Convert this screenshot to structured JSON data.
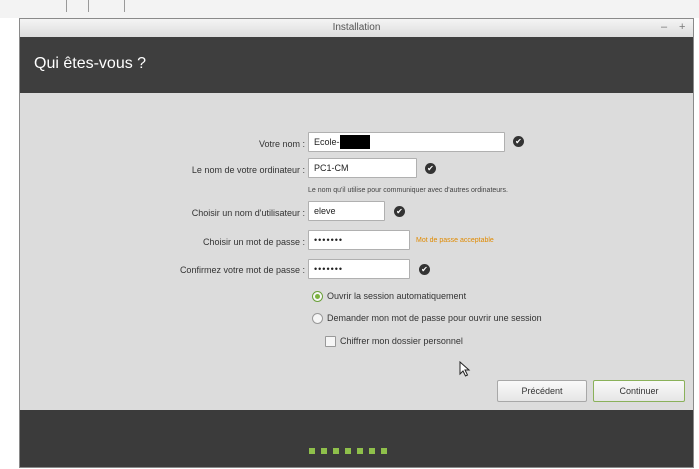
{
  "window": {
    "title": "Installation",
    "minimize_glyph": "–",
    "maximize_glyph": "+"
  },
  "header": {
    "title": "Qui êtes-vous ?"
  },
  "form": {
    "name_label": "Votre nom :",
    "name_value": "Ecole-",
    "computer_label": "Le nom de votre ordinateur :",
    "computer_value": "PC1-CM",
    "computer_hint": "Le nom qu'il utilise pour communiquer avec d'autres ordinateurs.",
    "username_label": "Choisir un nom d'utilisateur :",
    "username_value": "eleve",
    "password_label": "Choisir un mot de passe :",
    "password_value": "•••••••",
    "password_strength": "Mot de passe acceptable",
    "confirm_label": "Confirmez votre mot de passe :",
    "confirm_value": "•••••••",
    "check_glyph": "✔"
  },
  "options": {
    "auto_login": "Ouvrir la session automatiquement",
    "require_password": "Demander mon mot de passe pour ouvrir une session",
    "encrypt_home": "Chiffrer mon dossier personnel",
    "selected": "auto_login",
    "encrypt_checked": false
  },
  "buttons": {
    "back": "Précédent",
    "continue": "Continuer"
  },
  "progress": {
    "total_steps": 7
  },
  "colors": {
    "header_bg": "#3e3e3e",
    "accent_green": "#8fc04b",
    "warning_orange": "#e08a00"
  }
}
